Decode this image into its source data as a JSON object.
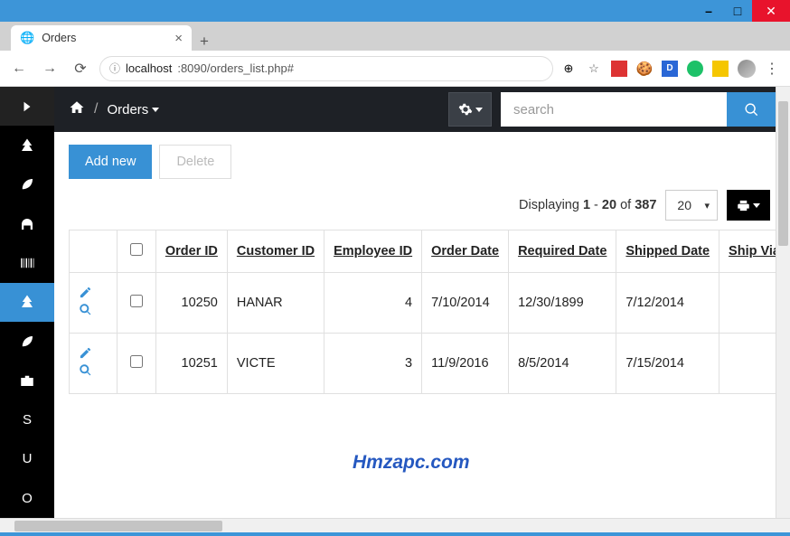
{
  "window": {
    "tab_title": "Orders"
  },
  "address": {
    "host": "localhost",
    "port_path": ":8090/orders_list.php#"
  },
  "breadcrumb": {
    "page": "Orders"
  },
  "search": {
    "placeholder": "search"
  },
  "toolbar": {
    "add_new": "Add new",
    "delete": "Delete"
  },
  "pager": {
    "prefix": "Displaying ",
    "from": "1",
    "to": "20",
    "of_word": " of ",
    "total": "387",
    "dash": " - ",
    "page_size": "20"
  },
  "columns": {
    "order_id": "Order ID",
    "customer_id": "Customer ID",
    "employee_id": "Employee ID",
    "order_date": "Order Date",
    "required_date": "Required Date",
    "shipped_date": "Shipped Date",
    "ship_via": "Ship Via"
  },
  "rows": [
    {
      "order_id": "10250",
      "customer_id": "HANAR",
      "employee_id": "4",
      "order_date": "7/10/2014",
      "required_date": "12/30/1899",
      "shipped_date": "7/12/2014"
    },
    {
      "order_id": "10251",
      "customer_id": "VICTE",
      "employee_id": "3",
      "order_date": "11/9/2016",
      "required_date": "8/5/2014",
      "shipped_date": "7/15/2014"
    }
  ],
  "sidebar_letters": {
    "s": "S",
    "u": "U",
    "o": "O"
  },
  "watermark": "Hmzapc.com"
}
